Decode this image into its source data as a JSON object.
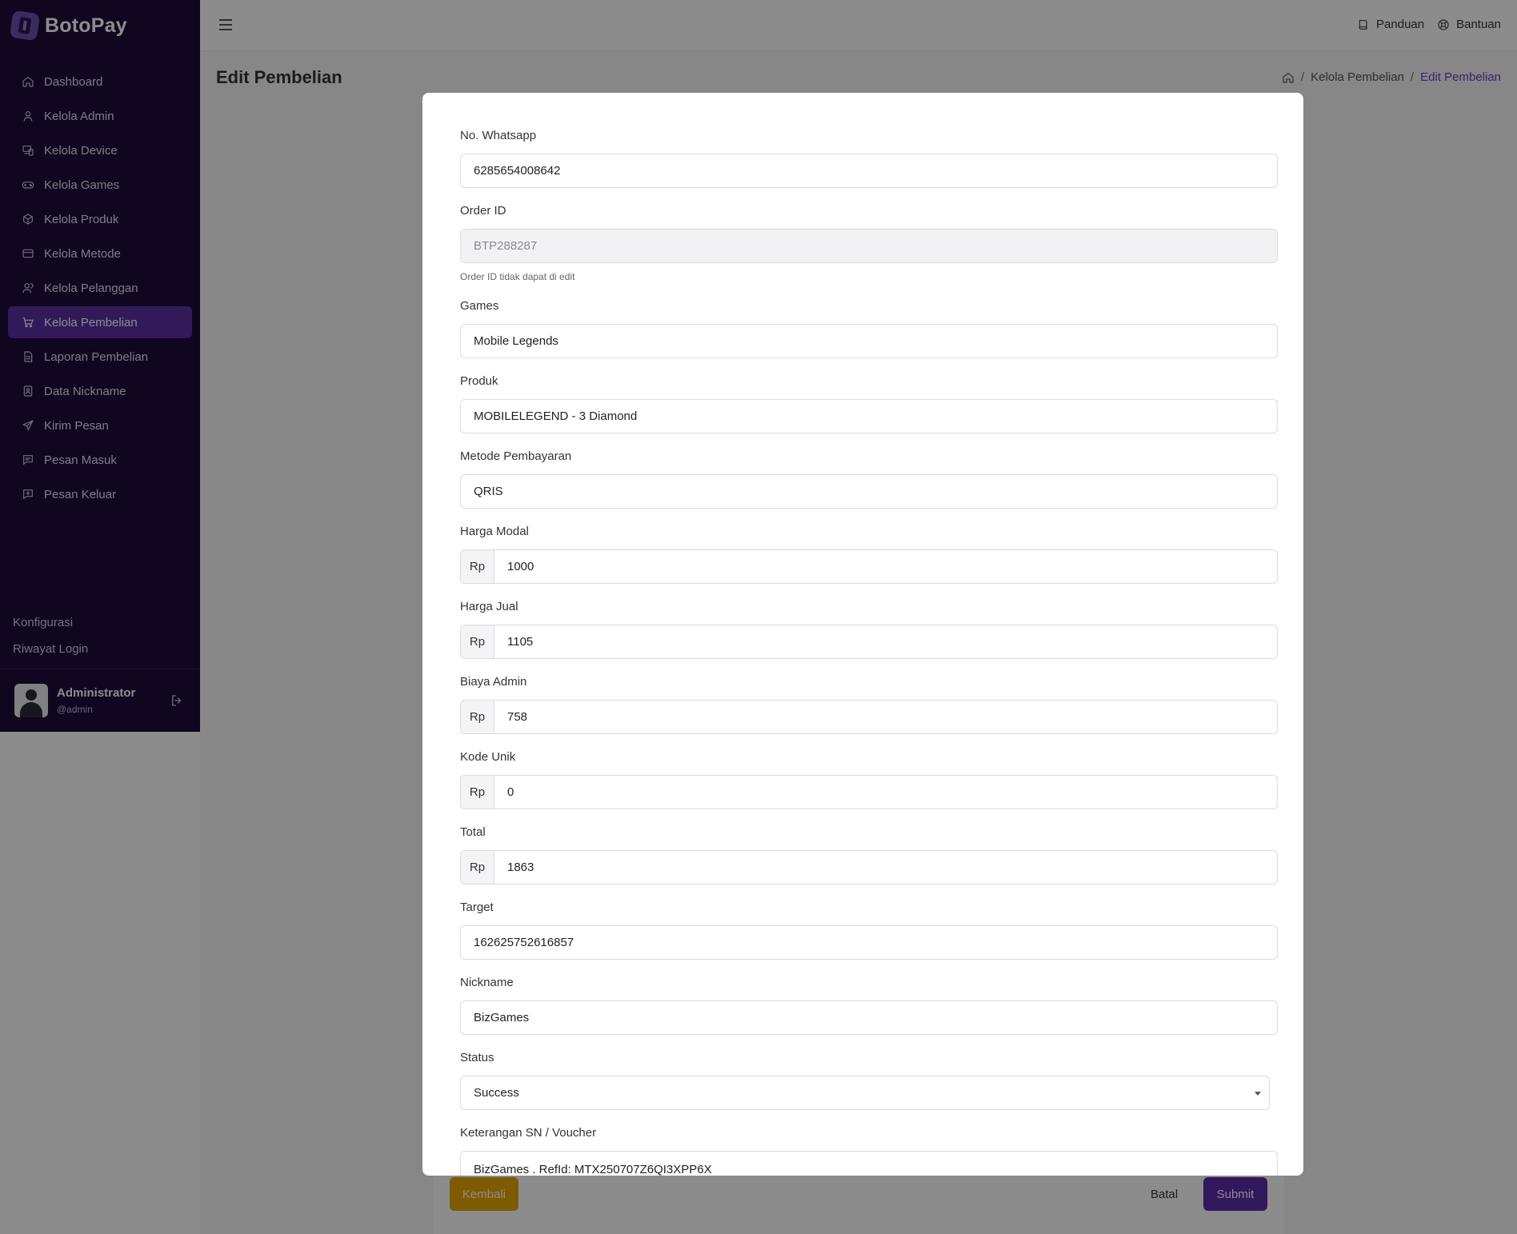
{
  "brand": {
    "name": "BotoPay"
  },
  "sidebar": {
    "items": [
      {
        "label": "Dashboard",
        "icon": "home-icon"
      },
      {
        "label": "Kelola Admin",
        "icon": "user-icon"
      },
      {
        "label": "Kelola Device",
        "icon": "devices-icon"
      },
      {
        "label": "Kelola Games",
        "icon": "gamepad-icon"
      },
      {
        "label": "Kelola Produk",
        "icon": "box-icon"
      },
      {
        "label": "Kelola Metode",
        "icon": "credit-card-icon"
      },
      {
        "label": "Kelola Pelanggan",
        "icon": "users-icon"
      },
      {
        "label": "Kelola Pembelian",
        "icon": "cart-icon",
        "active": true
      },
      {
        "label": "Laporan Pembelian",
        "icon": "report-icon"
      },
      {
        "label": "Data Nickname",
        "icon": "id-card-icon"
      },
      {
        "label": "Kirim Pesan",
        "icon": "send-icon"
      },
      {
        "label": "Pesan Masuk",
        "icon": "message-in-icon"
      },
      {
        "label": "Pesan Keluar",
        "icon": "message-out-icon"
      }
    ],
    "links": [
      "Konfigurasi",
      "Riwayat Login"
    ],
    "user": {
      "name": "Administrator",
      "handle": "@admin"
    }
  },
  "header": {
    "links": [
      {
        "label": "Panduan",
        "icon": "book-icon"
      },
      {
        "label": "Bantuan",
        "icon": "lifebuoy-icon"
      }
    ]
  },
  "page": {
    "title": "Edit Pembelian",
    "breadcrumb": [
      "Kelola Pembelian",
      "Edit Pembelian"
    ]
  },
  "form": {
    "whatsapp": {
      "label": "No. Whatsapp",
      "value": "6285654008642"
    },
    "order_id": {
      "label": "Order ID",
      "value": "BTP288287",
      "hint": "Order ID tidak dapat di edit"
    },
    "games": {
      "label": "Games",
      "value": "Mobile Legends"
    },
    "produk": {
      "label": "Produk",
      "value": "MOBILELEGEND - 3 Diamond"
    },
    "metode": {
      "label": "Metode Pembayaran",
      "value": "QRIS"
    },
    "currency": "Rp",
    "harga_modal": {
      "label": "Harga Modal",
      "value": "1000"
    },
    "harga_jual": {
      "label": "Harga Jual",
      "value": "1105"
    },
    "biaya_admin": {
      "label": "Biaya Admin",
      "value": "758"
    },
    "kode_unik": {
      "label": "Kode Unik",
      "value": "0"
    },
    "total": {
      "label": "Total",
      "value": "1863"
    },
    "target": {
      "label": "Target",
      "value": "162625752616857"
    },
    "nickname": {
      "label": "Nickname",
      "value": "BizGames"
    },
    "status": {
      "label": "Status",
      "value": "Success"
    },
    "keterangan": {
      "label": "Keterangan SN / Voucher",
      "value": "BizGames . RefId: MTX250707Z6QI3XPP6X"
    }
  },
  "actions": {
    "kembali": "Kembali",
    "batal": "Batal",
    "submit": "Submit"
  },
  "colors": {
    "sidebar_bg": "#1e0b3b",
    "active_nav": "#5b2fa3",
    "accent": "#6a3fc2",
    "submit": "#5a2aa6",
    "kembali": "#e6a400"
  }
}
